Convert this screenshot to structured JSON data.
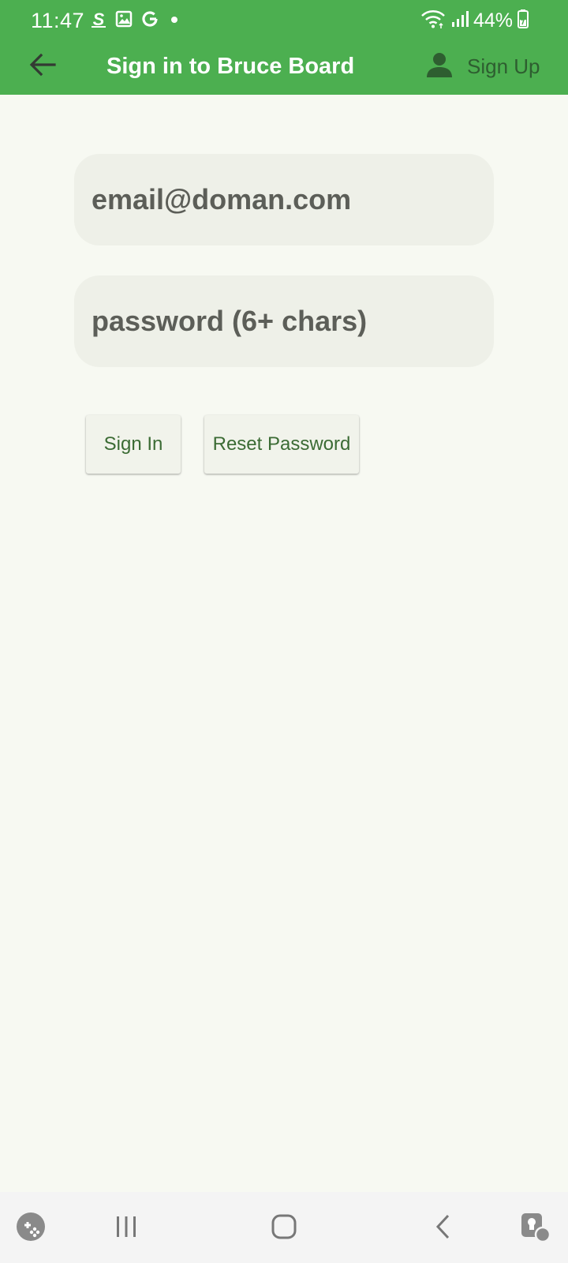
{
  "status_bar": {
    "time": "11:47",
    "notification_icons": [
      "s-app-icon",
      "image-icon",
      "google-icon",
      "dot-icon"
    ],
    "system_icons": [
      "wifi-icon",
      "signal-icon",
      "battery-icon"
    ],
    "battery": "44%"
  },
  "app_bar": {
    "title": "Sign in to Bruce Board",
    "back_icon": "back-arrow-icon",
    "signup_label": "Sign Up",
    "signup_icon": "person-icon"
  },
  "form": {
    "email_placeholder": "email@doman.com",
    "password_placeholder": "password (6+ chars)"
  },
  "buttons": {
    "sign_in": "Sign In",
    "reset_password": "Reset Password"
  },
  "nav_bar": {
    "items": [
      "game-launcher-icon",
      "recent-apps-icon",
      "home-icon",
      "back-icon",
      "accessibility-icon"
    ]
  },
  "colors": {
    "app_bar": "#4caf50",
    "background": "#f7f9f2",
    "field": "#eef0e8",
    "button_text": "#3b6b34"
  }
}
